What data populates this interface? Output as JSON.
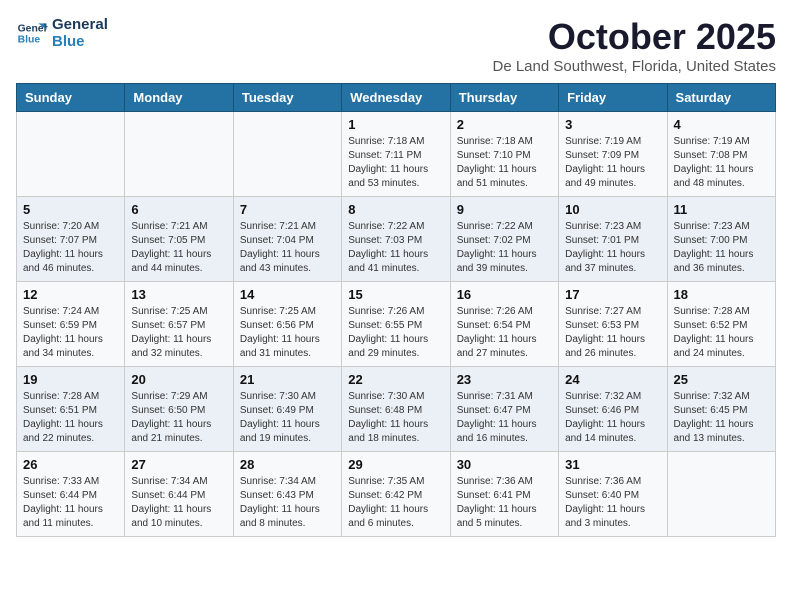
{
  "logo": {
    "line1": "General",
    "line2": "Blue"
  },
  "title": "October 2025",
  "subtitle": "De Land Southwest, Florida, United States",
  "days_of_week": [
    "Sunday",
    "Monday",
    "Tuesday",
    "Wednesday",
    "Thursday",
    "Friday",
    "Saturday"
  ],
  "weeks": [
    [
      {
        "day": "",
        "content": ""
      },
      {
        "day": "",
        "content": ""
      },
      {
        "day": "",
        "content": ""
      },
      {
        "day": "1",
        "content": "Sunrise: 7:18 AM\nSunset: 7:11 PM\nDaylight: 11 hours\nand 53 minutes."
      },
      {
        "day": "2",
        "content": "Sunrise: 7:18 AM\nSunset: 7:10 PM\nDaylight: 11 hours\nand 51 minutes."
      },
      {
        "day": "3",
        "content": "Sunrise: 7:19 AM\nSunset: 7:09 PM\nDaylight: 11 hours\nand 49 minutes."
      },
      {
        "day": "4",
        "content": "Sunrise: 7:19 AM\nSunset: 7:08 PM\nDaylight: 11 hours\nand 48 minutes."
      }
    ],
    [
      {
        "day": "5",
        "content": "Sunrise: 7:20 AM\nSunset: 7:07 PM\nDaylight: 11 hours\nand 46 minutes."
      },
      {
        "day": "6",
        "content": "Sunrise: 7:21 AM\nSunset: 7:05 PM\nDaylight: 11 hours\nand 44 minutes."
      },
      {
        "day": "7",
        "content": "Sunrise: 7:21 AM\nSunset: 7:04 PM\nDaylight: 11 hours\nand 43 minutes."
      },
      {
        "day": "8",
        "content": "Sunrise: 7:22 AM\nSunset: 7:03 PM\nDaylight: 11 hours\nand 41 minutes."
      },
      {
        "day": "9",
        "content": "Sunrise: 7:22 AM\nSunset: 7:02 PM\nDaylight: 11 hours\nand 39 minutes."
      },
      {
        "day": "10",
        "content": "Sunrise: 7:23 AM\nSunset: 7:01 PM\nDaylight: 11 hours\nand 37 minutes."
      },
      {
        "day": "11",
        "content": "Sunrise: 7:23 AM\nSunset: 7:00 PM\nDaylight: 11 hours\nand 36 minutes."
      }
    ],
    [
      {
        "day": "12",
        "content": "Sunrise: 7:24 AM\nSunset: 6:59 PM\nDaylight: 11 hours\nand 34 minutes."
      },
      {
        "day": "13",
        "content": "Sunrise: 7:25 AM\nSunset: 6:57 PM\nDaylight: 11 hours\nand 32 minutes."
      },
      {
        "day": "14",
        "content": "Sunrise: 7:25 AM\nSunset: 6:56 PM\nDaylight: 11 hours\nand 31 minutes."
      },
      {
        "day": "15",
        "content": "Sunrise: 7:26 AM\nSunset: 6:55 PM\nDaylight: 11 hours\nand 29 minutes."
      },
      {
        "day": "16",
        "content": "Sunrise: 7:26 AM\nSunset: 6:54 PM\nDaylight: 11 hours\nand 27 minutes."
      },
      {
        "day": "17",
        "content": "Sunrise: 7:27 AM\nSunset: 6:53 PM\nDaylight: 11 hours\nand 26 minutes."
      },
      {
        "day": "18",
        "content": "Sunrise: 7:28 AM\nSunset: 6:52 PM\nDaylight: 11 hours\nand 24 minutes."
      }
    ],
    [
      {
        "day": "19",
        "content": "Sunrise: 7:28 AM\nSunset: 6:51 PM\nDaylight: 11 hours\nand 22 minutes."
      },
      {
        "day": "20",
        "content": "Sunrise: 7:29 AM\nSunset: 6:50 PM\nDaylight: 11 hours\nand 21 minutes."
      },
      {
        "day": "21",
        "content": "Sunrise: 7:30 AM\nSunset: 6:49 PM\nDaylight: 11 hours\nand 19 minutes."
      },
      {
        "day": "22",
        "content": "Sunrise: 7:30 AM\nSunset: 6:48 PM\nDaylight: 11 hours\nand 18 minutes."
      },
      {
        "day": "23",
        "content": "Sunrise: 7:31 AM\nSunset: 6:47 PM\nDaylight: 11 hours\nand 16 minutes."
      },
      {
        "day": "24",
        "content": "Sunrise: 7:32 AM\nSunset: 6:46 PM\nDaylight: 11 hours\nand 14 minutes."
      },
      {
        "day": "25",
        "content": "Sunrise: 7:32 AM\nSunset: 6:45 PM\nDaylight: 11 hours\nand 13 minutes."
      }
    ],
    [
      {
        "day": "26",
        "content": "Sunrise: 7:33 AM\nSunset: 6:44 PM\nDaylight: 11 hours\nand 11 minutes."
      },
      {
        "day": "27",
        "content": "Sunrise: 7:34 AM\nSunset: 6:44 PM\nDaylight: 11 hours\nand 10 minutes."
      },
      {
        "day": "28",
        "content": "Sunrise: 7:34 AM\nSunset: 6:43 PM\nDaylight: 11 hours\nand 8 minutes."
      },
      {
        "day": "29",
        "content": "Sunrise: 7:35 AM\nSunset: 6:42 PM\nDaylight: 11 hours\nand 6 minutes."
      },
      {
        "day": "30",
        "content": "Sunrise: 7:36 AM\nSunset: 6:41 PM\nDaylight: 11 hours\nand 5 minutes."
      },
      {
        "day": "31",
        "content": "Sunrise: 7:36 AM\nSunset: 6:40 PM\nDaylight: 11 hours\nand 3 minutes."
      },
      {
        "day": "",
        "content": ""
      }
    ]
  ]
}
